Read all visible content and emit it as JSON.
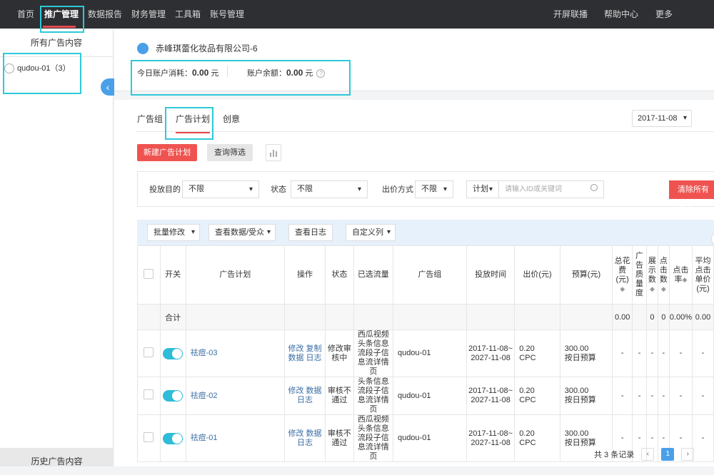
{
  "topnav": {
    "items": [
      "首页",
      "推广管理",
      "数据报告",
      "财务管理",
      "工具箱",
      "账号管理"
    ],
    "right_items": [
      "开屏联播",
      "帮助中心",
      "更多"
    ]
  },
  "sidebar": {
    "title": "所有广告内容",
    "account": "qudou-01（3）",
    "history": "历史广告内容"
  },
  "account_panel": {
    "company": "赤峰琪蕾化妆品有限公司-6",
    "cost_label": "今日账户消耗：",
    "cost_value": "0.00",
    "cost_unit": "元",
    "balance_label": "账户余额：",
    "balance_value": "0.00",
    "balance_unit": "元"
  },
  "tabs": [
    "广告组",
    "广告计划",
    "创意"
  ],
  "date": "2017-11-08",
  "actions": {
    "new_plan": "新建广告计划",
    "query_filter": "查询筛选"
  },
  "filters": {
    "purpose_label": "投放目的",
    "purpose_value": "不限",
    "status_label": "状态",
    "status_value": "不限",
    "bid_label": "出价方式",
    "bid_value": "不限",
    "plan_select": "计划",
    "search_placeholder": "请输入ID或关键词",
    "clear": "清除所有筛选"
  },
  "toolbar": {
    "batch": "批量修改",
    "view_data": "查看数据/受众",
    "view_log": "查看日志",
    "custom_cols": "自定义列"
  },
  "table": {
    "headers": [
      "开关",
      "广告计划",
      "操作",
      "状态",
      "已选流量",
      "广告组",
      "投放时间",
      "出价(元)",
      "预算(元)",
      "总花费(元)",
      "广告质量度",
      "展示数",
      "点击数",
      "点击率",
      "平均点击单价(元)"
    ],
    "summary": {
      "label": "合计",
      "total_cost": "0.00",
      "impressions": "0",
      "clicks": "0",
      "ctr": "0.00%",
      "avg_cpc": "0.00"
    },
    "rows": [
      {
        "plan": "祛痘-03",
        "op1": "修改 复制",
        "op2": "数据 日志",
        "status": "修改审核中",
        "traffic": "西瓜视频头条信息流段子信息流详情页",
        "group": "qudou-01",
        "time1": "2017-11-08~",
        "time2": "2027-11-08",
        "bid": "0.20",
        "bid_type": "CPC",
        "budget": "300.00",
        "budget_type": "按日预算",
        "dash": "-"
      },
      {
        "plan": "祛痘-02",
        "op1": "修改 数据",
        "op2": "日志",
        "status": "审核不通过",
        "traffic": "头条信息流段子信息流详情页",
        "group": "qudou-01",
        "time1": "2017-11-08~",
        "time2": "2027-11-08",
        "bid": "0.20",
        "bid_type": "CPC",
        "budget": "300.00",
        "budget_type": "按日预算",
        "dash": "-"
      },
      {
        "plan": "祛痘-01",
        "op1": "修改 数据",
        "op2": "日志",
        "status": "审核不通过",
        "traffic": "西瓜视频头条信息流段子信息流详情页",
        "group": "qudou-01",
        "time1": "2017-11-08~",
        "time2": "2027-11-08",
        "bid": "0.20",
        "bid_type": "CPC",
        "budget": "300.00",
        "budget_type": "按日预算",
        "dash": "-"
      }
    ]
  },
  "pager": {
    "total": "共 3 条记录",
    "current": "1",
    "prev": "‹",
    "next": "›"
  },
  "colors": {
    "highlight": "#2ec9d8",
    "accent_red": "#ef5350",
    "toggle_on": "#2ebcd8",
    "nav_bg": "#2e2f33"
  }
}
